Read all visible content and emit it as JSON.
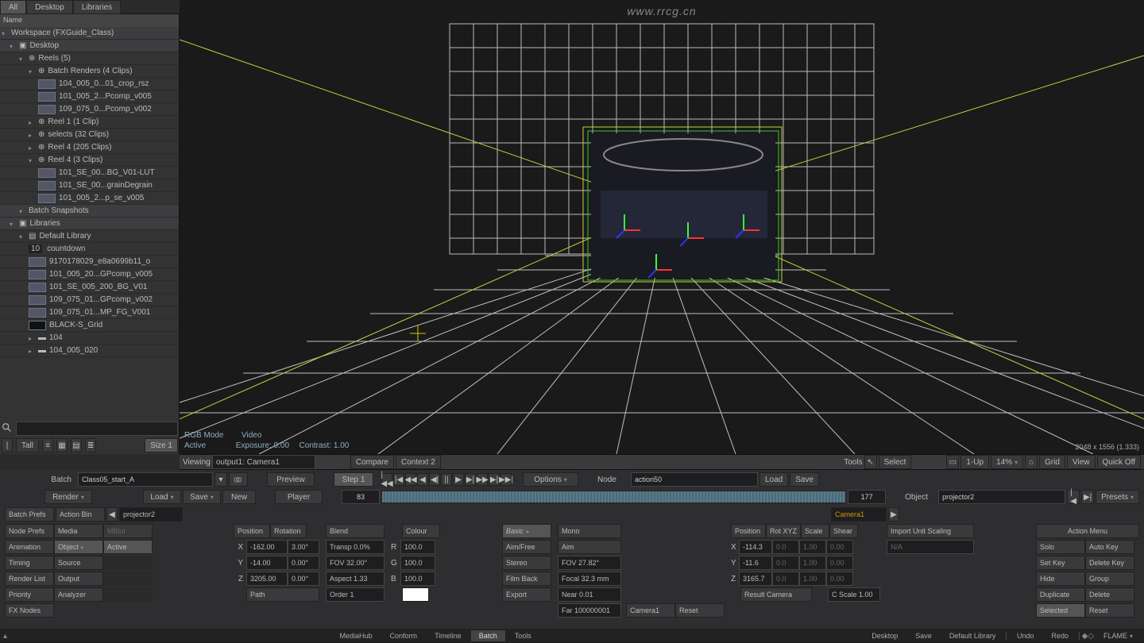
{
  "watermark": "www.rrcg.cn",
  "top_tabs": {
    "all": "All",
    "desktop": "Desktop",
    "libraries": "Libraries"
  },
  "sidebar": {
    "header": "Name",
    "workspace": "Workspace (FXGuide_Class)",
    "desktop": "Desktop",
    "reels": "Reels (5)",
    "batch_renders": "Batch Renders (4 Clips)",
    "clips": [
      "104_005_0...01_crop_rsz",
      "101_005_2...Pcomp_v005",
      "109_075_0...Pcomp_v002"
    ],
    "reel1": "Reel 1 (1 Clip)",
    "selects": "selects (32 Clips)",
    "reel4a": "Reel 4 (205 Clips)",
    "reel4b": "Reel 4 (3 Clips)",
    "reel4_clips": [
      "101_SE_00...BG_V01-LUT",
      "101_SE_00...grainDegrain",
      "101_005_2...p_se_v005"
    ],
    "batch_snapshots": "Batch Snapshots",
    "libraries": "Libraries",
    "default_lib": "Default Library",
    "countdown_num": "10",
    "countdown": "countdown",
    "lib_items": [
      "9170178029_e8a0699b11_o",
      "101_005_20...GPcomp_v005",
      "101_SE_005_200_BG_V01",
      "109_075_01...GPcomp_v002",
      "109_075_01...MP_FG_V001",
      "BLACK-S_Grid"
    ],
    "folders": [
      "104",
      "104_005_020"
    ]
  },
  "view_opts": {
    "tall": "Tall",
    "size1": "Size 1"
  },
  "viewport_info": {
    "mode": "RGB Mode",
    "active": "Active",
    "type": "Video",
    "exposure": "Exposure: 0.00",
    "contrast": "Contrast: 1.00",
    "dims": "2048 x 1556 (1.333)"
  },
  "viewbar": {
    "viewing": "Viewing",
    "output": "output1: Camera1",
    "compare": "Compare",
    "context2": "Context 2",
    "tools": "Tools",
    "select": "Select",
    "oneup": "1-Up",
    "zoom": "14%",
    "grid": "Grid",
    "view": "View",
    "quickoff": "Quick Off"
  },
  "batch_row1": {
    "batch": "Batch",
    "name": "Class05_start_A",
    "preview": "Preview",
    "step1": "Step 1",
    "options": "Options",
    "node": "Node",
    "node_val": "action50",
    "load": "Load",
    "save": "Save"
  },
  "batch_row2": {
    "render": "Render",
    "load": "Load",
    "save": "Save",
    "new": "New",
    "player": "Player",
    "frame_in": "83",
    "frame_out": "177",
    "object": "Object",
    "object_val": "projector2",
    "presets": "Presets"
  },
  "tabs_row": {
    "batch_prefs": "Batch Prefs",
    "action_bin": "Action Bin",
    "projector2": "projector2",
    "camera1": "Camera1"
  },
  "left_panel": {
    "rows": [
      [
        "Node Prefs",
        "Media",
        "MBlur"
      ],
      [
        "Animation",
        "Object",
        "Active"
      ],
      [
        "Timing",
        "Source",
        ""
      ],
      [
        "Render List",
        "Output",
        ""
      ],
      [
        "Priority",
        "Analyzer",
        ""
      ],
      [
        "FX Nodes",
        "",
        ""
      ]
    ]
  },
  "position_panel": {
    "headers": [
      "Position",
      "Rotation"
    ],
    "x": [
      "X",
      "-162.00",
      "3.00°"
    ],
    "y": [
      "Y",
      "-14.00",
      "0.00°"
    ],
    "z": [
      "Z",
      "3205.00",
      "0.00°"
    ],
    "path": "Path"
  },
  "blend_panel": {
    "header": "Blend",
    "transp": "Transp 0.0%",
    "fov": "FOV 32.00°",
    "aspect": "Aspect 1.33",
    "order": "Order 1"
  },
  "colour_panel": {
    "header": "Colour",
    "r": [
      "R",
      "100.0"
    ],
    "g": [
      "G",
      "100.0"
    ],
    "b": [
      "B",
      "100.0"
    ]
  },
  "camera_left": {
    "basic": "Basic",
    "aimfree": "Aim/Free",
    "stereo": "Stereo",
    "filmback": "Film Back",
    "export": "Export"
  },
  "camera_right": {
    "mono": "Mono",
    "aim": "Aim",
    "fov": "FOV 27.82°",
    "focal": "Focal 32.3 mm",
    "near": "Near 0.01",
    "far": "Far 100000001",
    "camera1": "Camera1",
    "reset": "Reset"
  },
  "cam_pos_panel": {
    "headers": [
      "Position",
      "Rot XYZ",
      "Scale",
      "Shear"
    ],
    "x": [
      "X",
      "-114.3",
      "0.0",
      "1.00",
      "0.00"
    ],
    "y": [
      "Y",
      "-11.6",
      "0.0",
      "1.00",
      "0.00"
    ],
    "z": [
      "Z",
      "3165.7",
      "0.0",
      "1.00",
      "0.00"
    ],
    "result": "Result Camera",
    "cscale": "C Scale 1.00"
  },
  "import_panel": {
    "label": "Import Unit Scaling",
    "na": "N/A"
  },
  "action_menu": {
    "title": "Action Menu",
    "solo": "Solo",
    "autokey": "Auto Key",
    "setkey": "Set Key",
    "deletekey": "Delete Key",
    "hide": "Hide",
    "group": "Group",
    "duplicate": "Duplicate",
    "delete": "Delete",
    "selected": "Selected",
    "reset": "Reset"
  },
  "footer": {
    "left_tabs": [
      "MediaHub",
      "Conform",
      "Timeline",
      "Batch",
      "Tools"
    ],
    "right": {
      "desktop": "Desktop",
      "save": "Save",
      "deflib": "Default Library",
      "undo": "Undo",
      "redo": "Redo",
      "flame": "FLAME"
    }
  }
}
